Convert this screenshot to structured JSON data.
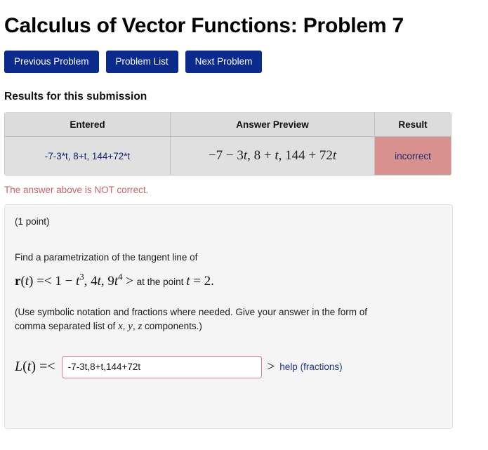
{
  "page": {
    "title": "Calculus of Vector Functions: Problem 7"
  },
  "nav": {
    "previous_label": "Previous Problem",
    "problem_list_label": "Problem List",
    "next_label": "Next Problem"
  },
  "results": {
    "heading": "Results for this submission",
    "columns": [
      "Entered",
      "Answer Preview",
      "Result"
    ],
    "row": {
      "entered": "-7-3*t, 8+t, 144+72*t",
      "preview": {
        "full": "−7 − 3t, 8 + t, 144 + 72t",
        "part1_pre": "−7 − 3",
        "part1_var": "t",
        "part2_pre": ", 8 + ",
        "part2_var": "t",
        "part3_pre": ", 144 + 72",
        "part3_var": "t"
      },
      "result": "incorrect"
    },
    "status_message": "The answer above is NOT correct.",
    "status_color": "#c9636b",
    "incorrect_bg": "#d9918f",
    "incorrect_fg": "#1e2a78"
  },
  "problem": {
    "point_note": "(1 point)",
    "prompt": "Find a parametrization of the tangent line of",
    "formula": {
      "vec_name": "r",
      "vec_arg_open": "(",
      "vec_arg_var": "t",
      "vec_arg_close": ")",
      "equals_open": " =< ",
      "comp1_num": "1 − ",
      "comp1_var": "t",
      "comp1_exp": "3",
      "comp2_num": ", 4",
      "comp2_var": "t",
      "comp3_num": ", 9",
      "comp3_var": "t",
      "comp3_exp": "4",
      "angle_close": " > ",
      "tail_text": "at the point ",
      "tail_var": "t",
      "tail_rest": " = 2."
    },
    "instructions_line1": "(Use symbolic notation and fractions where needed. Give your answer in the form of",
    "instructions_line2_pre": "comma separated list of ",
    "instructions_var_x": "x",
    "instructions_sep1": ",  ",
    "instructions_var_y": "y",
    "instructions_sep2": ",  ",
    "instructions_var_z": "z",
    "instructions_line2_post": " components.)"
  },
  "answer": {
    "label_fn": "L",
    "label_open": "(",
    "label_var": "t",
    "label_close": ") =<",
    "input_value": "-7-3t,8+t,144+72t",
    "input_placeholder": "",
    "angle_close": ">",
    "help_label": "help (fractions)",
    "input_border_color": "#d9808a"
  }
}
